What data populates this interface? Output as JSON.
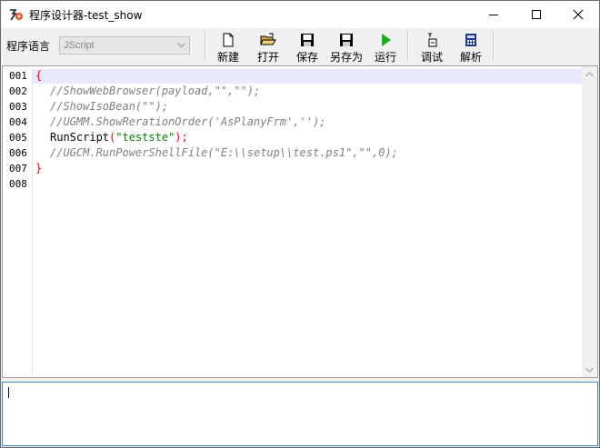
{
  "window": {
    "title": "程序设计器-test_show",
    "controls": {
      "minimize": "minimize-icon",
      "maximize": "maximize-icon",
      "close": "close-icon"
    }
  },
  "toolbar": {
    "lang_label": "程序语言",
    "lang_value": "JScript",
    "buttons": [
      {
        "id": "new",
        "label": "新建",
        "icon": "new-file-icon"
      },
      {
        "id": "open",
        "label": "打开",
        "icon": "open-folder-icon"
      },
      {
        "id": "save",
        "label": "保存",
        "icon": "save-icon"
      },
      {
        "id": "saveas",
        "label": "另存为",
        "icon": "save-as-icon"
      },
      {
        "id": "run",
        "label": "运行",
        "icon": "run-icon"
      },
      {
        "id": "debug",
        "label": "调试",
        "icon": "debug-icon"
      },
      {
        "id": "parse",
        "label": "解析",
        "icon": "calculator-icon"
      }
    ]
  },
  "editor": {
    "line_numbers": [
      "001",
      "002",
      "003",
      "004",
      "005",
      "006",
      "007",
      "008"
    ],
    "lines": [
      {
        "brace": "{"
      },
      {
        "comment": "//ShowWebBrowser(payload,\"\",\"\");"
      },
      {
        "comment": "//ShowIsoBean(\"\");"
      },
      {
        "comment": "//UGMM.ShowRerationOrder('AsPlanyFrm','');"
      },
      {
        "ident": "RunScript",
        "open": "(",
        "str": "\"testste\"",
        "close": ")",
        "end": ";"
      },
      {
        "comment": "//UGCM.RunPowerShellFile(\"E:\\\\setup\\\\test.ps1\",\"\",0);"
      },
      {
        "brace": "}"
      },
      {}
    ]
  },
  "colors": {
    "comment": "#808080",
    "brace": "#ff0000",
    "string": "#008000",
    "focus_border": "#3c86d4"
  }
}
